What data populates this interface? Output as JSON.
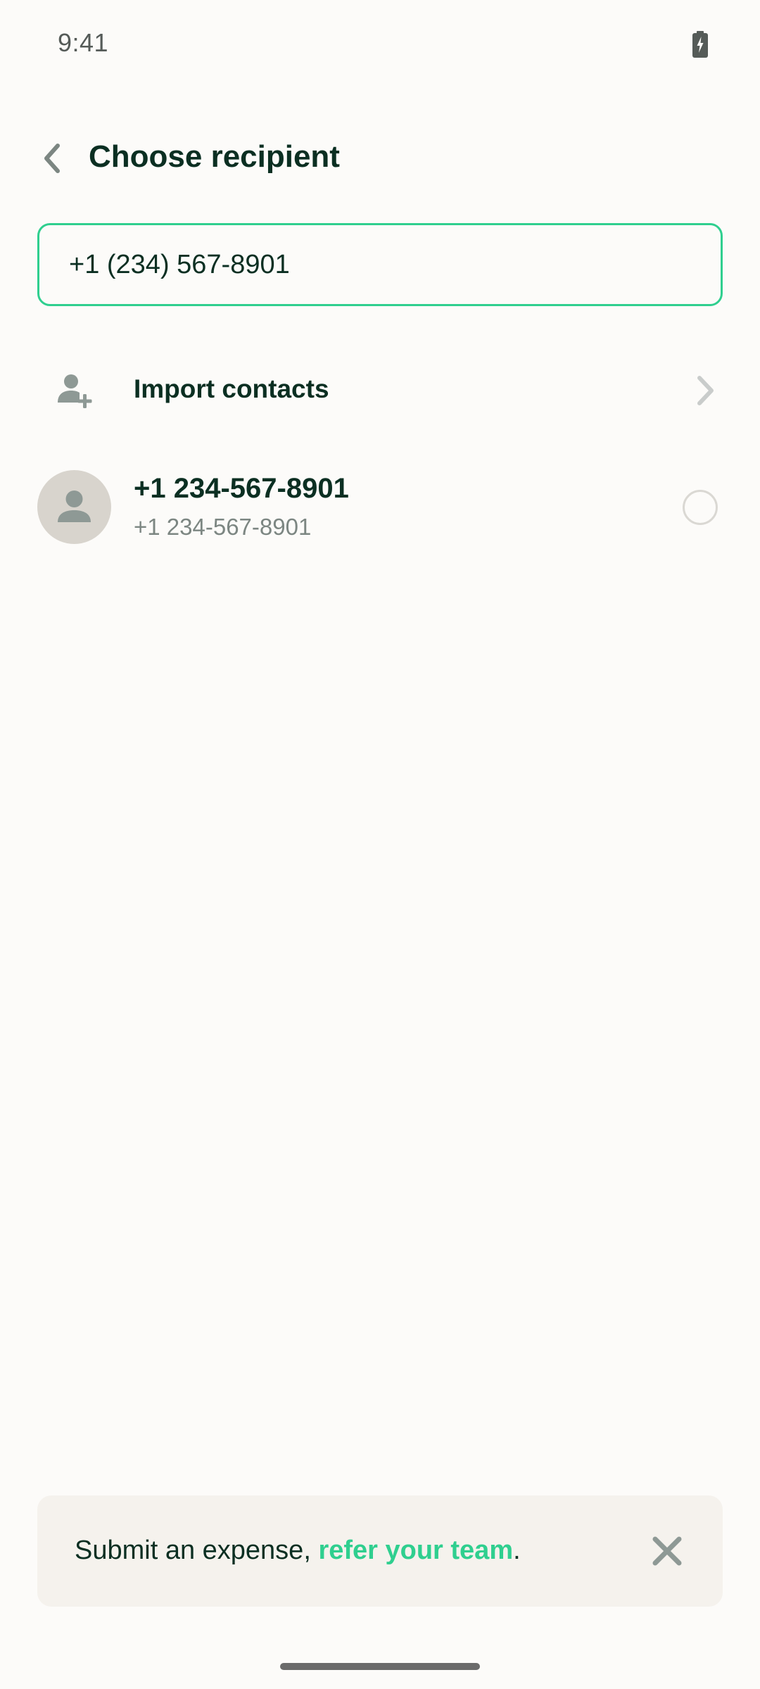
{
  "status_bar": {
    "time": "9:41",
    "battery_icon": "battery-charging-icon"
  },
  "header": {
    "back_icon": "chevron-left-icon",
    "title": "Choose recipient"
  },
  "search": {
    "value": "+1 (234) 567-8901",
    "border_color": "#2fcf8f"
  },
  "import_contacts": {
    "icon": "add-user-icon",
    "label": "Import contacts",
    "chevron_icon": "chevron-right-icon"
  },
  "contacts": [
    {
      "name": "+1 234-567-8901",
      "subtitle": "+1 234-567-8901",
      "avatar_icon": "person-icon",
      "selected": false
    }
  ],
  "banner": {
    "text_prefix": "Submit an expense, ",
    "link_text": "refer your team",
    "text_suffix": ".",
    "close_icon": "close-icon",
    "link_color": "#2fcf8f"
  },
  "colors": {
    "accent": "#2fcf8f",
    "text_primary": "#0b2f22",
    "text_secondary": "#7c8682",
    "background": "#fcfbf9"
  }
}
